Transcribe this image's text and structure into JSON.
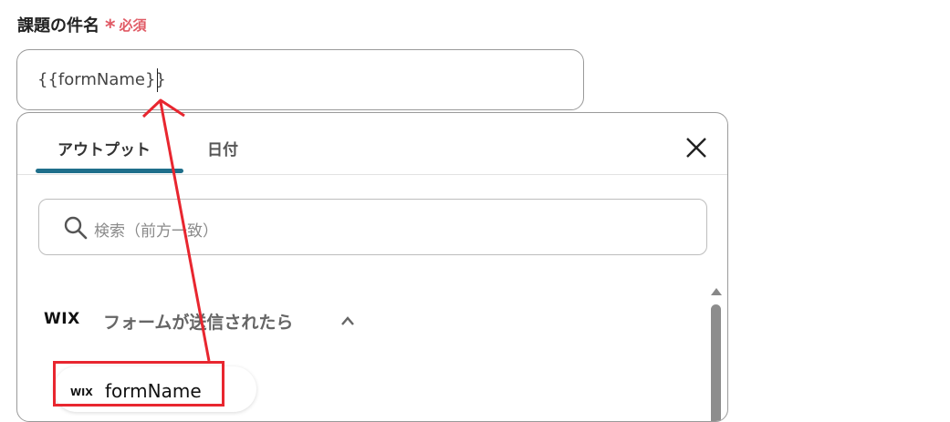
{
  "field": {
    "label": "課題の件名",
    "required_star": "*",
    "required_text": "必須",
    "value": "{{formName}}"
  },
  "panel": {
    "tabs": [
      {
        "label": "アウトプット",
        "active": true
      },
      {
        "label": "日付",
        "active": false
      }
    ],
    "search_placeholder": "検索（前方一致）",
    "section": {
      "logo_text": "WIX",
      "title": "フォームが送信されたら",
      "expanded": true
    },
    "items": [
      {
        "logo_text": "WIX",
        "label": "formName"
      }
    ]
  },
  "colors": {
    "accent_tab": "#1f6f8b",
    "required": "#e05a65",
    "annotation": "#e8262f"
  }
}
